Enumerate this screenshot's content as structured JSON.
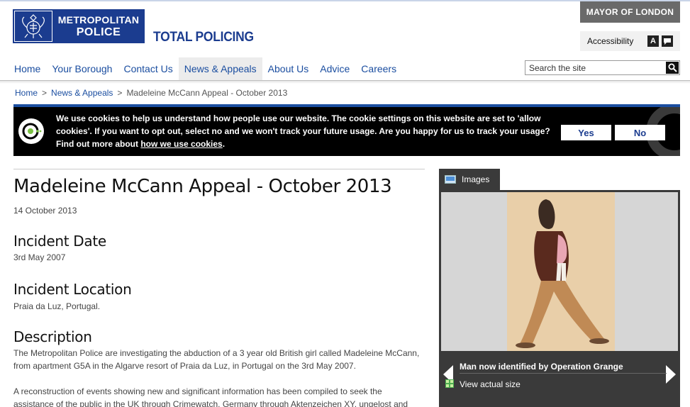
{
  "header": {
    "logo_line1": "METROPOLITAN",
    "logo_line2": "POLICE",
    "tagline": "TOTAL POLICING",
    "mayor": "MAYOR OF LONDON",
    "accessibility": "Accessibility",
    "accessibility_a": "A"
  },
  "nav": {
    "items": [
      "Home",
      "Your Borough",
      "Contact Us",
      "News & Appeals",
      "About Us",
      "Advice",
      "Careers"
    ],
    "active": "News & Appeals"
  },
  "search": {
    "placeholder": "Search the site"
  },
  "breadcrumb": {
    "items": [
      "Home",
      "News & Appeals",
      "Madeleine McCann Appeal - October 2013"
    ],
    "separator": ">"
  },
  "cookie": {
    "text": "We use cookies to help us understand how people use our website. The cookie settings on this website are set to 'allow cookies'. If you want to opt out, select no and we won't track your future usage. Are you happy for us to track your usage? Find out more about",
    "link": "how we use cookies",
    "after_link": ".",
    "yes": "Yes",
    "no": "No"
  },
  "article": {
    "title": "Madeleine McCann Appeal - October 2013",
    "date": "14 October 2013",
    "incident_date_heading": "Incident Date",
    "incident_date": "3rd May 2007",
    "incident_location_heading": "Incident Location",
    "incident_location": "Praia da Luz, Portugal.",
    "description_heading": "Description",
    "para1": "The Metropolitan Police are investigating the abduction of a 3 year old British girl called Madeleine McCann, from apartment G5A in the Algarve resort of Praia da Luz, in Portugal on the 3rd May 2007.",
    "para2": "A reconstruction of events showing new and significant information has been compiled to seek the assistance of the public in the UK through Crimewatch, Germany through Aktenzeichen XY, ungelost and"
  },
  "images": {
    "tab_label": "Images",
    "caption": "Man now identified by Operation Grange",
    "view_actual": "View actual size"
  },
  "colors": {
    "brand_blue": "#1b3c8f",
    "link_blue": "#1b4ea0",
    "panel_dark": "#3a3a3a"
  }
}
